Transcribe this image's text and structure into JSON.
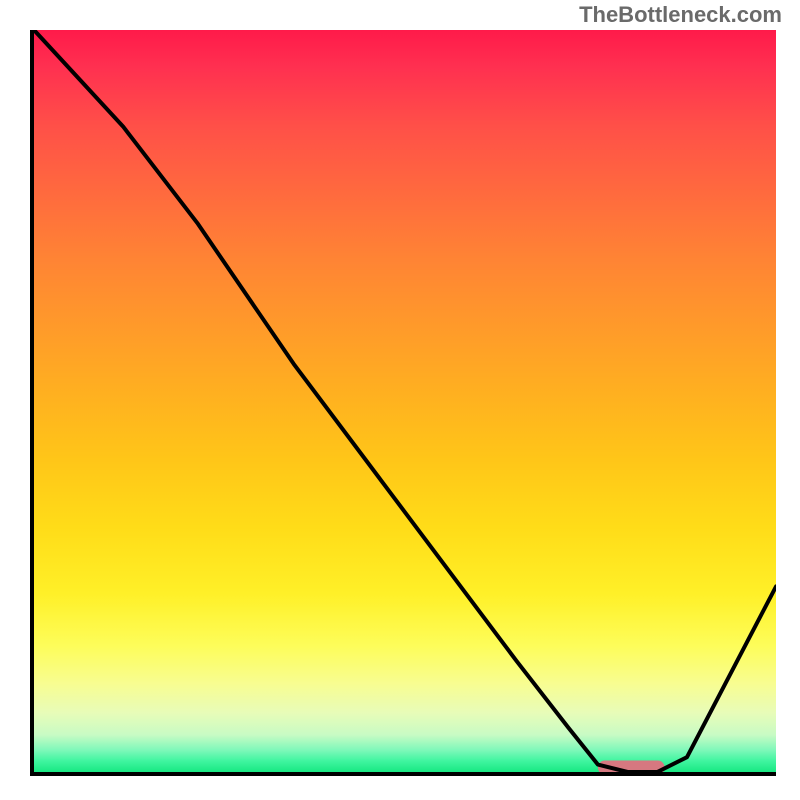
{
  "watermark": "TheBottleneck.com",
  "chart_data": {
    "type": "line",
    "title": "",
    "xlabel": "",
    "ylabel": "",
    "xlim": [
      0,
      100
    ],
    "ylim": [
      0,
      100
    ],
    "series": [
      {
        "name": "curve",
        "x": [
          0,
          12,
          22,
          35,
          50,
          65,
          72,
          76,
          80,
          84,
          88,
          100
        ],
        "values": [
          100,
          87,
          74,
          55,
          35,
          15,
          6,
          1,
          0,
          0,
          2,
          25
        ]
      }
    ],
    "marker": {
      "x_start": 76,
      "x_end": 85,
      "y": 0.6,
      "color": "#d67880"
    },
    "gradient_stops": [
      {
        "pos": 0,
        "color": "#ff1a4a"
      },
      {
        "pos": 50,
        "color": "#ffc020"
      },
      {
        "pos": 85,
        "color": "#fdfd60"
      },
      {
        "pos": 100,
        "color": "#18e882"
      }
    ]
  }
}
